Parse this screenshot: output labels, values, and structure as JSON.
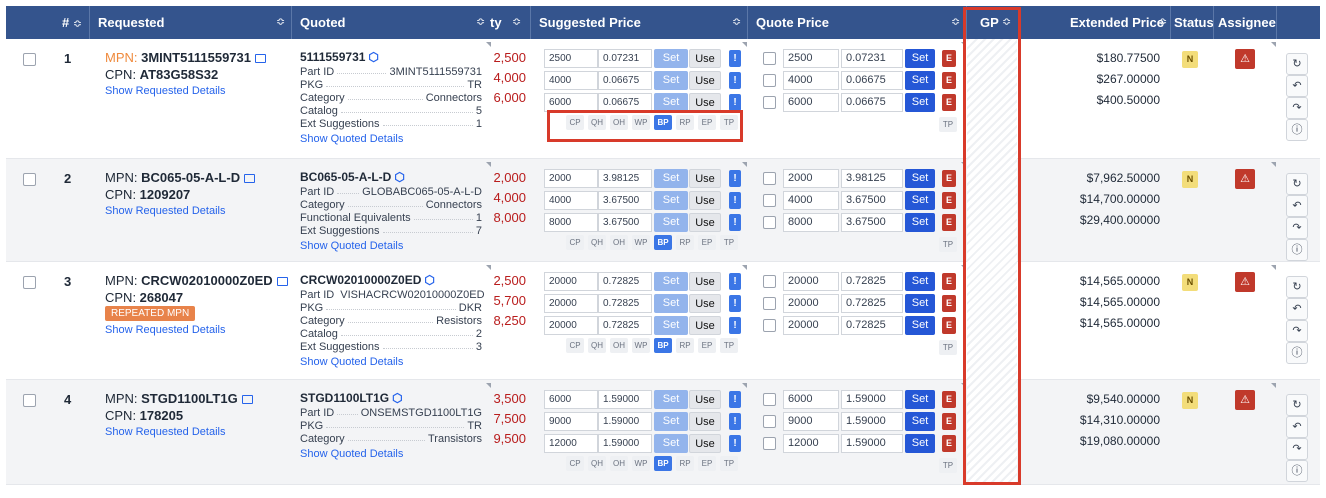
{
  "header": {
    "num": "#",
    "requested": "Requested",
    "quoted": "Quoted",
    "qty": "ty",
    "suggested": "Suggested Price",
    "quote_price": "Quote Price",
    "gp": "GP",
    "extended": "Extended Price",
    "status": "Status",
    "assignee": "Assignee",
    "sort_glyph": "≎"
  },
  "labels": {
    "mpn": "MPN: ",
    "cpn": "CPN: ",
    "show_requested": "Show Requested Details",
    "show_quoted": "Show Quoted Details",
    "set": "Set",
    "use": "Use",
    "excl": "!",
    "e": "E",
    "repeated": "REPEATED MPN",
    "status_n": "N",
    "tp": "TP"
  },
  "source_tags": [
    "CP",
    "QH",
    "OH",
    "WP",
    "BP",
    "RP",
    "EP",
    "TP"
  ],
  "active_source_tag": "BP",
  "rows": [
    {
      "num": "1",
      "mpn": "3MINT5111559731",
      "cpn": "AT83G58S32",
      "repeated": false,
      "quoted_title": "5111559731",
      "details": [
        {
          "k": "Part ID",
          "v": "3MINT5111559731"
        },
        {
          "k": "PKG",
          "v": "TR"
        },
        {
          "k": "Category",
          "v": "Connectors"
        },
        {
          "k": "Catalog",
          "v": "5"
        },
        {
          "k": "Ext Suggestions",
          "v": "1"
        }
      ],
      "qty": [
        "2,500",
        "4,000",
        "6,000"
      ],
      "suggested": [
        [
          "2500",
          "0.07231"
        ],
        [
          "4000",
          "0.06675"
        ],
        [
          "6000",
          "0.06675"
        ]
      ],
      "quote": [
        [
          "2500",
          "0.07231"
        ],
        [
          "4000",
          "0.06675"
        ],
        [
          "6000",
          "0.06675"
        ]
      ],
      "extended": [
        "$180.77500",
        "$267.00000",
        "$400.50000"
      ]
    },
    {
      "num": "2",
      "mpn": "BC065-05-A-L-D",
      "cpn": "1209207",
      "repeated": false,
      "quoted_title": "BC065-05-A-L-D",
      "details": [
        {
          "k": "Part ID",
          "v": "GLOBABC065-05-A-L-D"
        },
        {
          "k": "Category",
          "v": "Connectors"
        },
        {
          "k": "Functional Equivalents",
          "v": "1"
        },
        {
          "k": "Ext Suggestions",
          "v": "7"
        }
      ],
      "qty": [
        "2,000",
        "4,000",
        "8,000"
      ],
      "suggested": [
        [
          "2000",
          "3.98125"
        ],
        [
          "4000",
          "3.67500"
        ],
        [
          "8000",
          "3.67500"
        ]
      ],
      "quote": [
        [
          "2000",
          "3.98125"
        ],
        [
          "4000",
          "3.67500"
        ],
        [
          "8000",
          "3.67500"
        ]
      ],
      "extended": [
        "$7,962.50000",
        "$14,700.00000",
        "$29,400.00000"
      ]
    },
    {
      "num": "3",
      "mpn": "CRCW02010000Z0ED",
      "cpn": "268047",
      "repeated": true,
      "quoted_title": "CRCW02010000Z0ED",
      "details": [
        {
          "k": "Part ID",
          "v": "VISHACRCW02010000Z0ED"
        },
        {
          "k": "PKG",
          "v": "DKR"
        },
        {
          "k": "Category",
          "v": "Resistors"
        },
        {
          "k": "Catalog",
          "v": "2"
        },
        {
          "k": "Ext Suggestions",
          "v": "3"
        }
      ],
      "qty": [
        "2,500",
        "5,700",
        "8,250"
      ],
      "suggested": [
        [
          "20000",
          "0.72825"
        ],
        [
          "20000",
          "0.72825"
        ],
        [
          "20000",
          "0.72825"
        ]
      ],
      "quote": [
        [
          "20000",
          "0.72825"
        ],
        [
          "20000",
          "0.72825"
        ],
        [
          "20000",
          "0.72825"
        ]
      ],
      "extended": [
        "$14,565.00000",
        "$14,565.00000",
        "$14,565.00000"
      ]
    },
    {
      "num": "4",
      "mpn": "STGD1100LT1G",
      "cpn": "178205",
      "repeated": false,
      "quoted_title": "STGD1100LT1G",
      "details": [
        {
          "k": "Part ID",
          "v": "ONSEMSTGD1100LT1G"
        },
        {
          "k": "PKG",
          "v": "TR"
        },
        {
          "k": "Category",
          "v": "Transistors"
        }
      ],
      "qty": [
        "3,500",
        "7,500",
        "9,500"
      ],
      "suggested": [
        [
          "6000",
          "1.59000"
        ],
        [
          "9000",
          "1.59000"
        ],
        [
          "12000",
          "1.59000"
        ]
      ],
      "quote": [
        [
          "6000",
          "1.59000"
        ],
        [
          "9000",
          "1.59000"
        ],
        [
          "12000",
          "1.59000"
        ]
      ],
      "extended": [
        "$9,540.00000",
        "$14,310.00000",
        "$19,080.00000"
      ]
    }
  ],
  "side_icons": [
    "refresh-icon",
    "history-icon",
    "redo-icon",
    "info-icon"
  ],
  "side_glyphs": [
    "↻",
    "↶",
    "↷",
    "ⓘ"
  ],
  "warning_glyph": "⚠",
  "cube_glyph": "⬡",
  "colors": {
    "header_bg": "#34548d",
    "highlight_red": "#d83a2a",
    "link_blue": "#2563eb",
    "qty_red": "#b91c1c",
    "repeated_orange": "#e8834a",
    "status_yellow": "#f3dd7a"
  }
}
